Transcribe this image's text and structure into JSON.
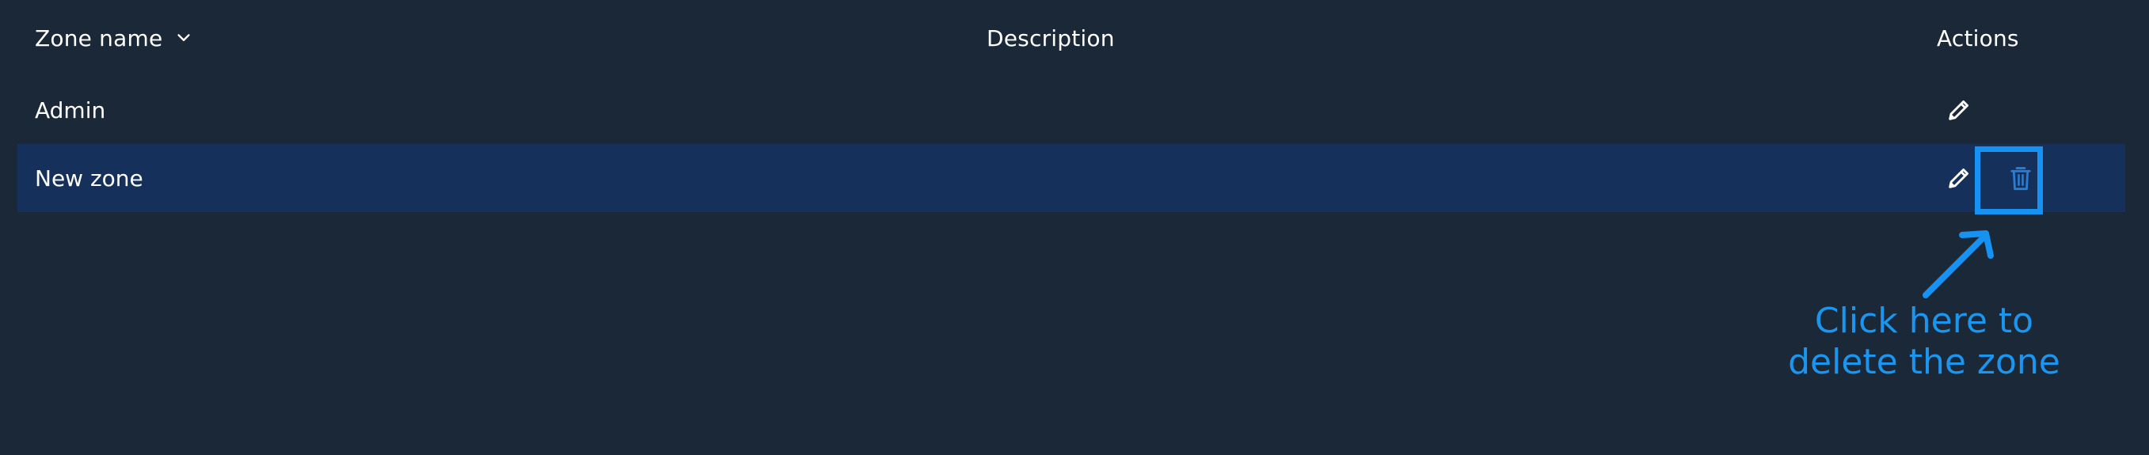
{
  "table": {
    "headers": {
      "zone_name": "Zone name",
      "description": "Description",
      "actions": "Actions"
    },
    "rows": [
      {
        "zone_name": "Admin",
        "description": "",
        "actions": [
          "edit"
        ]
      },
      {
        "zone_name": "New zone",
        "description": "",
        "actions": [
          "edit",
          "delete"
        ]
      }
    ],
    "sort_icon": "chevron-down-icon"
  },
  "annotation": {
    "text_line1": "Click here to",
    "text_line2": "delete the zone",
    "color": "#1592f2"
  },
  "colors": {
    "background": "#1b2838",
    "selected_row": "#15305a",
    "accent": "#1592f2",
    "delete_icon": "#2a7fd4"
  }
}
